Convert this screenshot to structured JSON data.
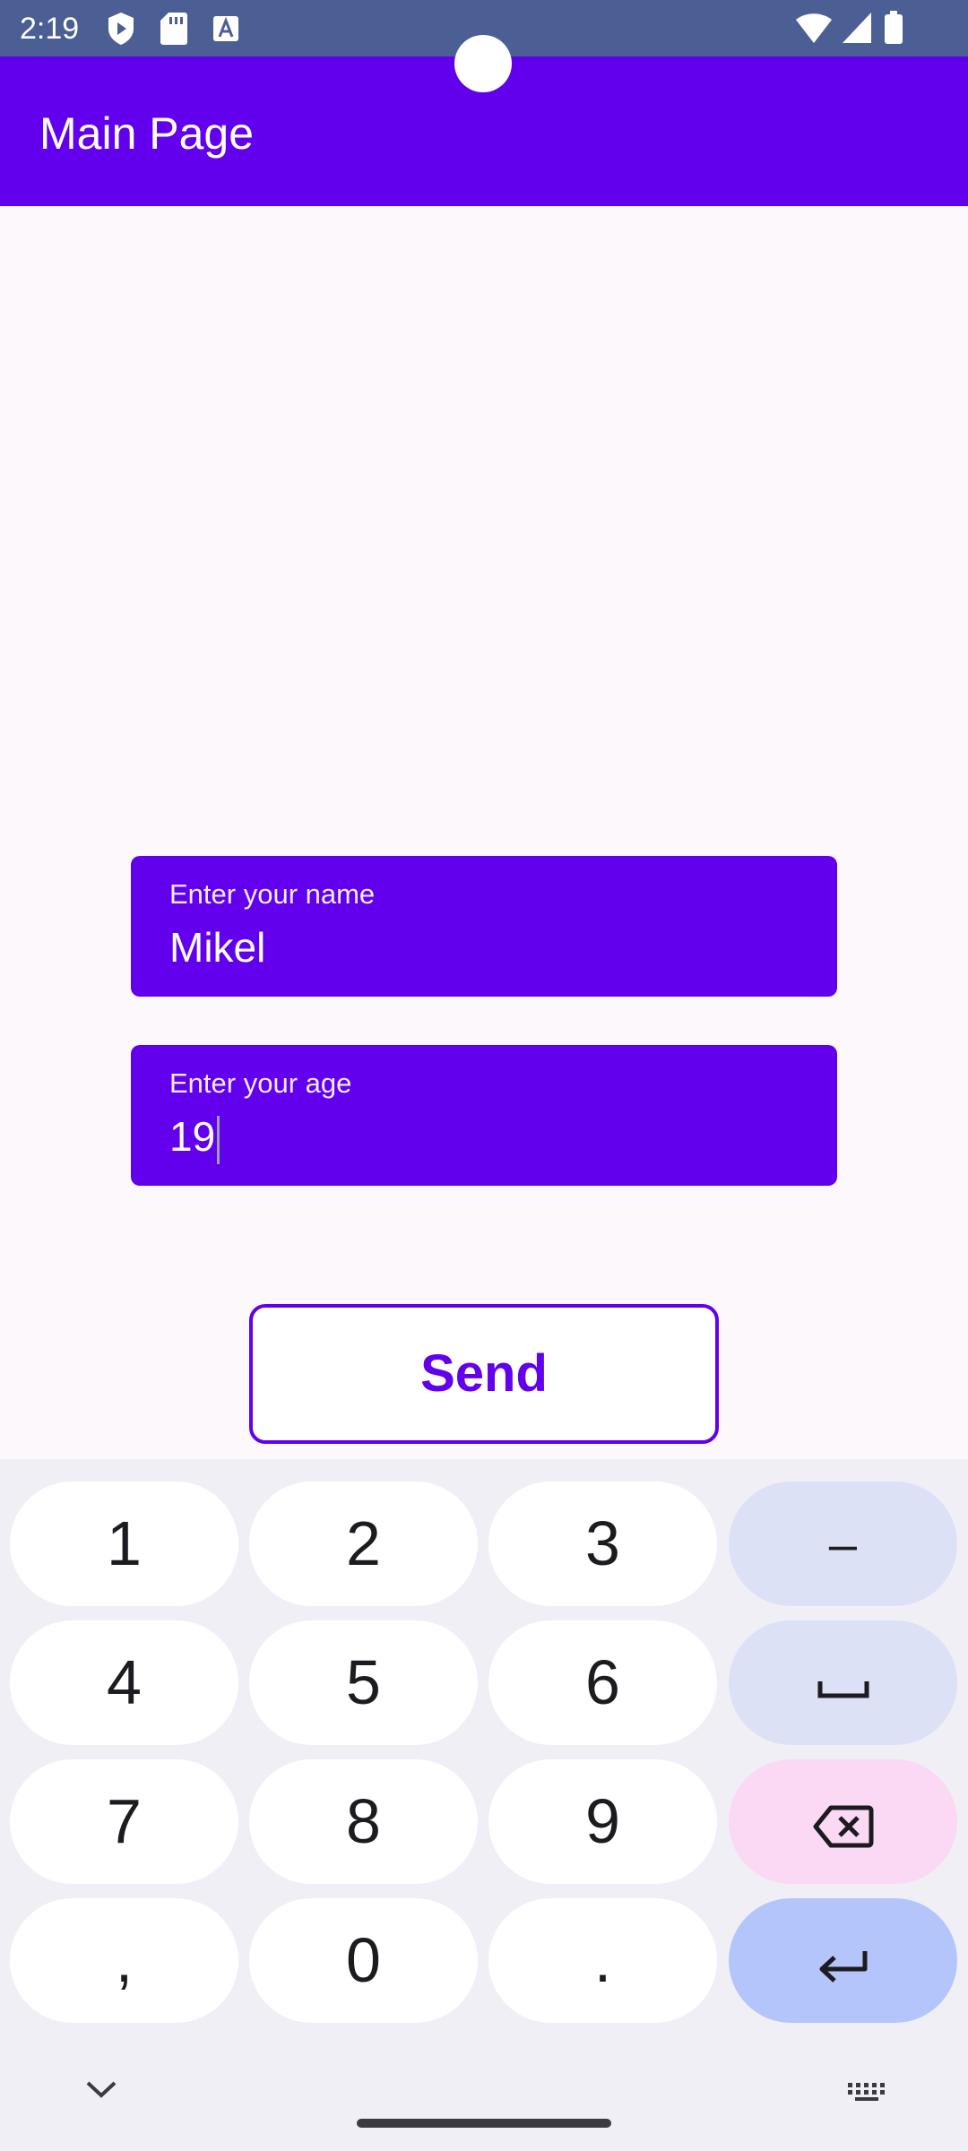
{
  "status_bar": {
    "time": "2:19",
    "icons_left": [
      "shield-play-icon",
      "sd-card-icon",
      "text-a-icon"
    ],
    "icons_right": [
      "wifi-icon",
      "cell-signal-icon",
      "battery-icon"
    ]
  },
  "app_bar": {
    "title": "Main Page"
  },
  "form": {
    "name_field": {
      "label": "Enter your name",
      "value": "Mikel"
    },
    "age_field": {
      "label": "Enter your age",
      "value": "19"
    },
    "send_label": "Send"
  },
  "keyboard": {
    "rows": [
      [
        "1",
        "2",
        "3",
        "–"
      ],
      [
        "4",
        "5",
        "6",
        "space"
      ],
      [
        "7",
        "8",
        "9",
        "backspace"
      ],
      [
        ",",
        "0",
        ".",
        "enter"
      ]
    ],
    "k1": "1",
    "k2": "2",
    "k3": "3",
    "kdash": "–",
    "k4": "4",
    "k5": "5",
    "k6": "6",
    "k7": "7",
    "k8": "8",
    "k9": "9",
    "kcomma": ",",
    "k0": "0",
    "kdot": "."
  },
  "colors": {
    "primary": "#6200ee",
    "status_bar": "#4c5f94",
    "background": "#fdf8fc",
    "key_func": "#dde1f5",
    "key_delete": "#fbd8f3",
    "key_enter": "#b3c5fb"
  }
}
